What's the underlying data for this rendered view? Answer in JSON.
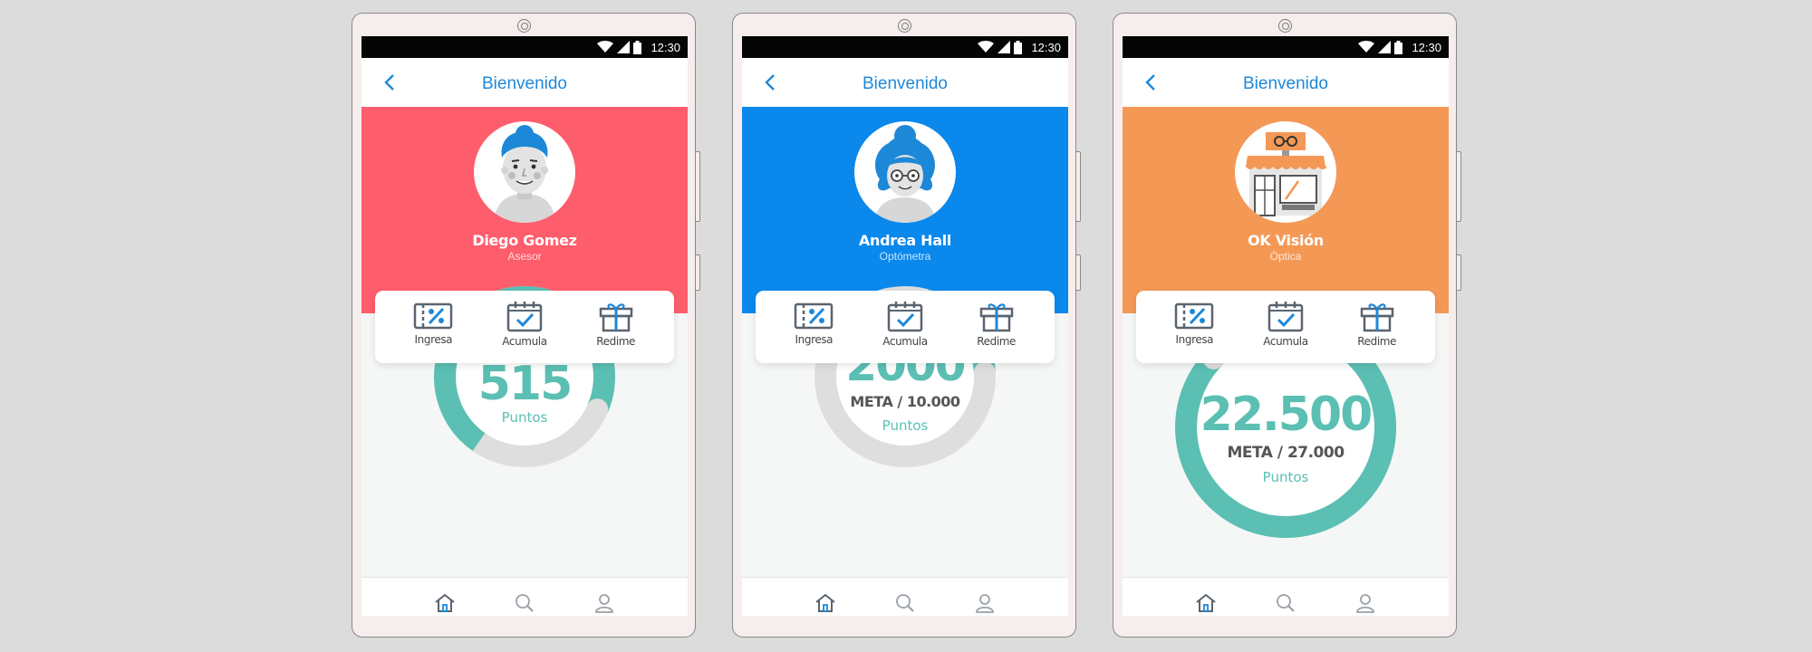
{
  "status_bar": {
    "time": "12:30"
  },
  "app_bar": {
    "title": "Bienvenido"
  },
  "actions": [
    {
      "label": "Ingresa",
      "icon": "ticket-percent-icon"
    },
    {
      "label": "Acumula",
      "icon": "calendar-check-icon"
    },
    {
      "label": "Redime",
      "icon": "gift-icon"
    }
  ],
  "bottom_nav": [
    "home-icon",
    "search-icon",
    "user-icon"
  ],
  "colors": {
    "accent_blue": "#1e88d8",
    "teal": "#5bbfb3",
    "gauge_track": "#dedede"
  },
  "screens": [
    {
      "hero_color": "#fe5d6c",
      "name": "Diego Gomez",
      "role": "Asesor",
      "avatar": "man-avatar",
      "points": "515",
      "meta": "",
      "points_label": "Puntos",
      "progress": 0.72
    },
    {
      "hero_color": "#0a88ec",
      "name": "Andrea Hall",
      "role": "Optómetra",
      "avatar": "woman-avatar",
      "points": "2000",
      "meta": "META / 10.000",
      "points_label": "Puntos",
      "progress": 0.2
    },
    {
      "hero_color": "#f49856",
      "name": "OK Visión",
      "role": "Óptica",
      "avatar": "optical-store-avatar",
      "points": "22.500",
      "meta": "META / 27.000",
      "points_label": "Puntos",
      "progress": 0.83
    }
  ]
}
